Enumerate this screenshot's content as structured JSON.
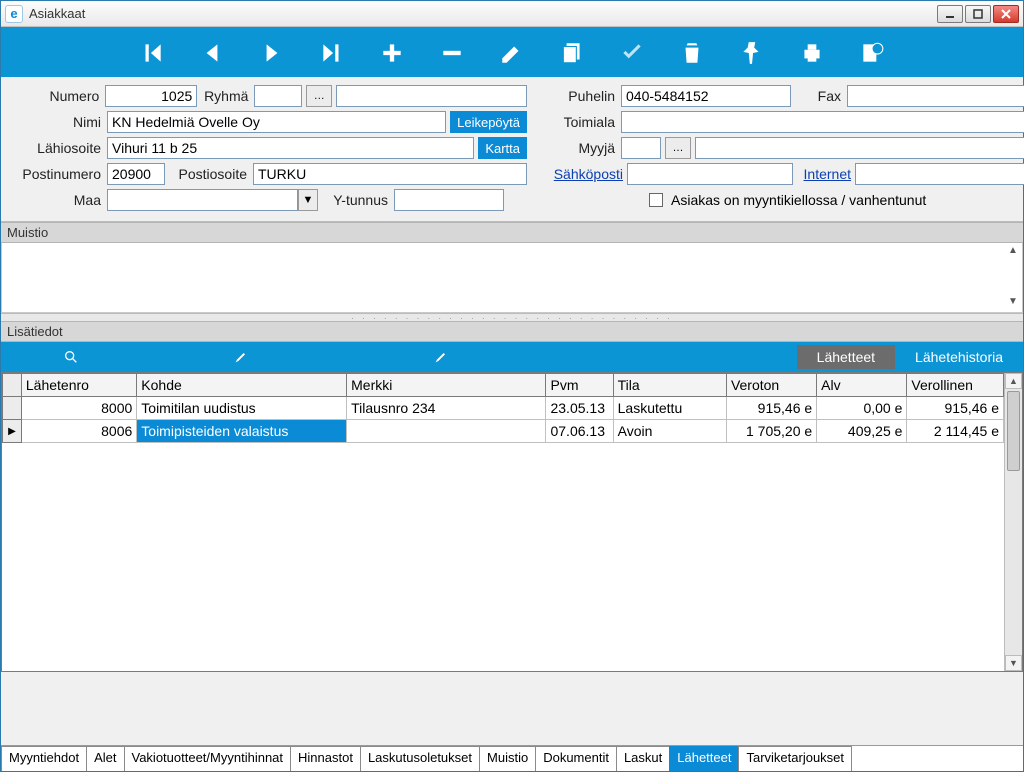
{
  "window": {
    "title": "Asiakkaat"
  },
  "toolbar_icons": [
    "first",
    "prev",
    "next",
    "last",
    "plus",
    "minus",
    "edit",
    "copy",
    "check",
    "trash",
    "torch",
    "print",
    "export"
  ],
  "form": {
    "numero_label": "Numero",
    "numero": "1025",
    "ryhma_label": "Ryhmä",
    "ryhma": "",
    "nimi_label": "Nimi",
    "nimi": "KN Hedelmiä Ovelle Oy",
    "leikepoyta_btn": "Leikepöytä",
    "lahiosoite_label": "Lähiosoite",
    "lahiosoite": "Vihuri 11 b 25",
    "kartta_btn": "Kartta",
    "postinumero_label": "Postinumero",
    "postinumero": "20900",
    "postiosoite_label": "Postiosoite",
    "postiosoite": "TURKU",
    "maa_label": "Maa",
    "maa": "",
    "ytunnus_label": "Y-tunnus",
    "ytunnus": "",
    "puhelin_label": "Puhelin",
    "puhelin": "040-5484152",
    "fax_label": "Fax",
    "fax": "",
    "toimiala_label": "Toimiala",
    "toimiala": "",
    "myyja_label": "Myyjä",
    "myyja": "",
    "sahkoposti_label": "Sähköposti",
    "sahkoposti": "",
    "internet_label": "Internet",
    "internet": "",
    "myyntikielto_label": "Asiakas on myyntikiellossa / vanhentunut"
  },
  "sections": {
    "muistio": "Muistio",
    "lisatiedot": "Lisätiedot"
  },
  "subtabs": {
    "lahetteet": "Lähetteet",
    "lahetehistoria": "Lähetehistoria"
  },
  "grid": {
    "headers": {
      "lahetenro": "Lähetenro",
      "kohde": "Kohde",
      "merkki": "Merkki",
      "pvm": "Pvm",
      "tila": "Tila",
      "veroton": "Veroton",
      "alv": "Alv",
      "verollinen": "Verollinen"
    },
    "rows": [
      {
        "lahetenro": "8000",
        "kohde": "Toimitilan uudistus",
        "merkki": "Tilausnro 234",
        "pvm": "23.05.13",
        "tila": "Laskutettu",
        "veroton": "915,46 e",
        "alv": "0,00 e",
        "verollinen": "915,46 e"
      },
      {
        "lahetenro": "8006",
        "kohde": "Toimipisteiden valaistus",
        "merkki": "",
        "pvm": "07.06.13",
        "tila": "Avoin",
        "veroton": "1 705,20 e",
        "alv": "409,25 e",
        "verollinen": "2 114,45 e"
      }
    ]
  },
  "bottom_tabs": [
    "Myyntiehdot",
    "Alet",
    "Vakiotuotteet/Myyntihinnat",
    "Hinnastot",
    "Laskutusoletukset",
    "Muistio",
    "Dokumentit",
    "Laskut",
    "Lähetteet",
    "Tarviketarjoukset"
  ],
  "bottom_active": "Lähetteet"
}
